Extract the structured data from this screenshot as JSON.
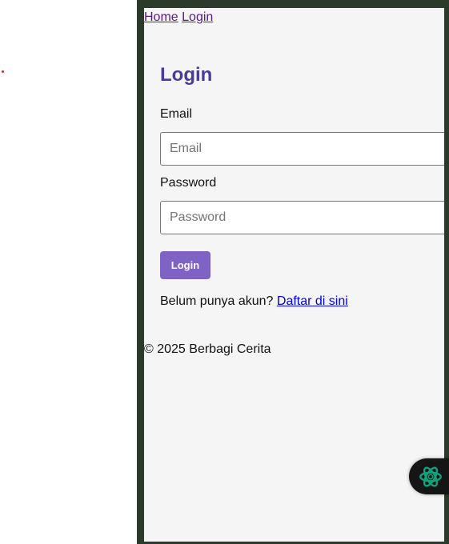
{
  "nav": {
    "home": "Home",
    "login": "Login"
  },
  "form": {
    "title": "Login",
    "email_label": "Email",
    "email_placeholder": "Email",
    "password_label": "Password",
    "password_placeholder": "Password",
    "submit_label": "Login",
    "register_prompt": "Belum punya akun?",
    "register_link": "Daftar di sini"
  },
  "footer": {
    "text": "© 2025 Berbagi Cerita"
  },
  "floating_button": {
    "icon": "ai-assistant-icon",
    "color": "#10a37f"
  },
  "colors": {
    "accent": "#7e62c4",
    "title": "#4b3a9a",
    "frame": "#2c3a2b",
    "page_background": "#f5f5f5"
  }
}
